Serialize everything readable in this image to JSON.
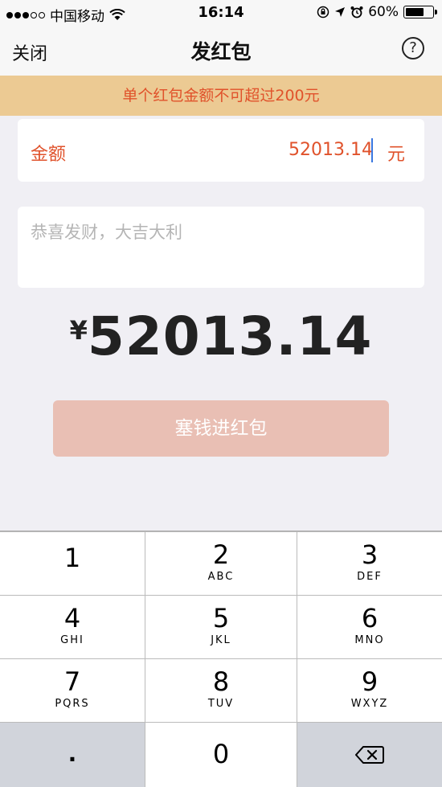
{
  "status_bar": {
    "carrier": "中国移动",
    "time": "16:14",
    "battery": "60%",
    "icons": [
      "signal-dots-icon",
      "wifi-icon",
      "rotation-lock-icon",
      "location-icon",
      "alarm-icon",
      "battery-icon"
    ]
  },
  "nav": {
    "close_label": "关闭",
    "title": "发红包",
    "help_label": "?"
  },
  "notice": "单个红包金额不可超过200元",
  "amount": {
    "label": "金额",
    "value": "52013.14",
    "unit": "元"
  },
  "message": {
    "placeholder": "恭喜发财，大吉大利"
  },
  "total": {
    "currency": "¥",
    "value": "52013.14"
  },
  "send_button": "塞钱进红包",
  "keypad": [
    {
      "num": "1",
      "letters": ""
    },
    {
      "num": "2",
      "letters": "ABC"
    },
    {
      "num": "3",
      "letters": "DEF"
    },
    {
      "num": "4",
      "letters": "GHI"
    },
    {
      "num": "5",
      "letters": "JKL"
    },
    {
      "num": "6",
      "letters": "MNO"
    },
    {
      "num": "7",
      "letters": "PQRS"
    },
    {
      "num": "8",
      "letters": "TUV"
    },
    {
      "num": "9",
      "letters": "WXYZ"
    },
    {
      "num": ".",
      "letters": ""
    },
    {
      "num": "0",
      "letters": ""
    }
  ],
  "colors": {
    "accent": "#e0522b",
    "notice_bg": "#ecca93",
    "button_disabled": "#e9bfb4"
  }
}
